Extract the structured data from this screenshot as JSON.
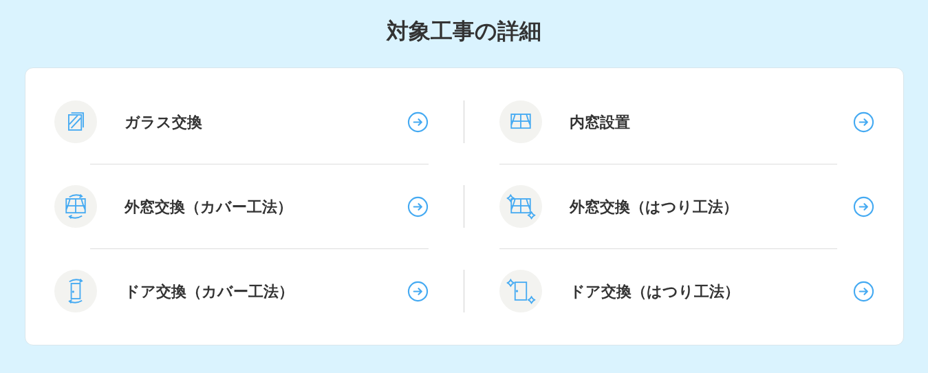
{
  "title": "対象工事の詳細",
  "items": [
    {
      "label": "ガラス交換",
      "kind": "glass"
    },
    {
      "label": "内窓設置",
      "kind": "inner-window"
    },
    {
      "label": "外窓交換（カバー工法）",
      "kind": "window-cover"
    },
    {
      "label": "外窓交換（はつり工法）",
      "kind": "window-hatsuri"
    },
    {
      "label": "ドア交換（カバー工法）",
      "kind": "door-cover"
    },
    {
      "label": "ドア交換（はつり工法）",
      "kind": "door-hatsuri"
    }
  ]
}
